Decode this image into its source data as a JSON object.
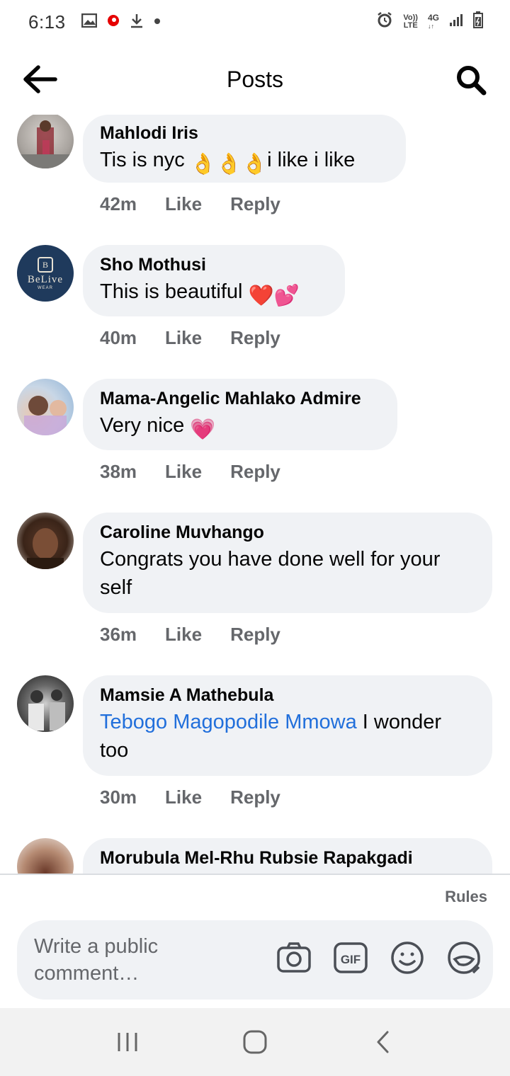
{
  "status_bar": {
    "time": "6:13",
    "network": "4G",
    "volte_top": "Vo))",
    "volte_bottom": "LTE"
  },
  "header": {
    "title": "Posts"
  },
  "comments": [
    {
      "author": "Mahlodi Iris",
      "text_before": "Tis is nyc ",
      "emojis": [
        "👌",
        "👌",
        "👌"
      ],
      "text_after": "i like i like",
      "time": "42m",
      "like": "Like",
      "reply": "Reply"
    },
    {
      "author": "Sho Mothusi",
      "text_before": "This is beautiful ",
      "emojis": [
        "❤️",
        "💕"
      ],
      "text_after": "",
      "time": "40m",
      "like": "Like",
      "reply": "Reply",
      "avatar_text": "BeLive",
      "avatar_subtext": "WEAR"
    },
    {
      "author": "Mama-Angelic Mahlako Admire",
      "text_before": "Very nice ",
      "emojis": [
        "💗"
      ],
      "text_after": "",
      "time": "38m",
      "like": "Like",
      "reply": "Reply"
    },
    {
      "author": "Caroline Muvhango",
      "text": "Congrats you have done well for your self",
      "time": "36m",
      "like": "Like",
      "reply": "Reply"
    },
    {
      "author": "Mamsie A Mathebula",
      "mention": "Tebogo Magopodile Mmowa",
      "text_after": " I wonder too",
      "time": "30m",
      "like": "Like",
      "reply": "Reply"
    },
    {
      "author": "Morubula Mel-Rhu Rubsie Rapakgadi"
    }
  ],
  "footer": {
    "rules": "Rules",
    "placeholder": "Write a public comment…",
    "gif_label": "GIF"
  },
  "colors": {
    "bubble": "#f0f2f5",
    "mention": "#216fdb",
    "secondary_text": "#65676b"
  }
}
